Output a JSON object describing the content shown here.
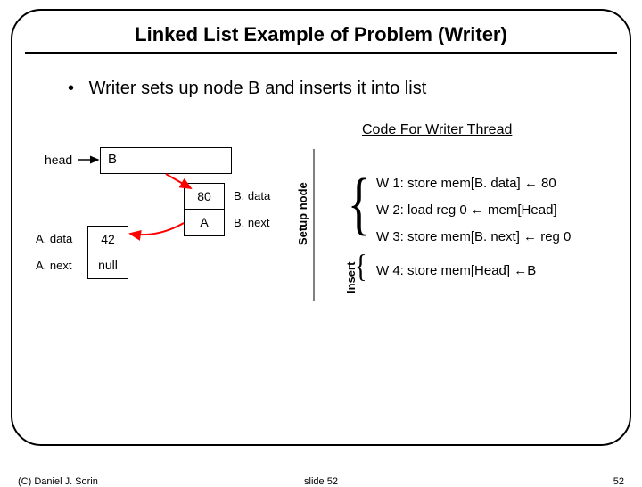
{
  "title": "Linked List Example of Problem (Writer)",
  "bullet": "Writer sets up node B and inserts it into list",
  "code_title": "Code For Writer Thread",
  "labels": {
    "head": "head",
    "b_box": "B",
    "a_data": "A. data",
    "a_next": "A. next",
    "b_data": "B. data",
    "b_next": "B. next",
    "setup": "Setup node",
    "insert": "Insert"
  },
  "node_a": {
    "data": "42",
    "next": "null"
  },
  "node_b": {
    "data": "80",
    "next": "A"
  },
  "code": {
    "w1": "W 1: store mem[B. data] ← 80",
    "w2": "W 2: load reg 0 ← mem[Head]",
    "w3": "W 3: store mem[B. next] ← reg 0",
    "w4": "W 4: store mem[Head] ←B"
  },
  "footer": {
    "copyright": "(C) Daniel J. Sorin",
    "center": "slide 52",
    "page": "52"
  }
}
